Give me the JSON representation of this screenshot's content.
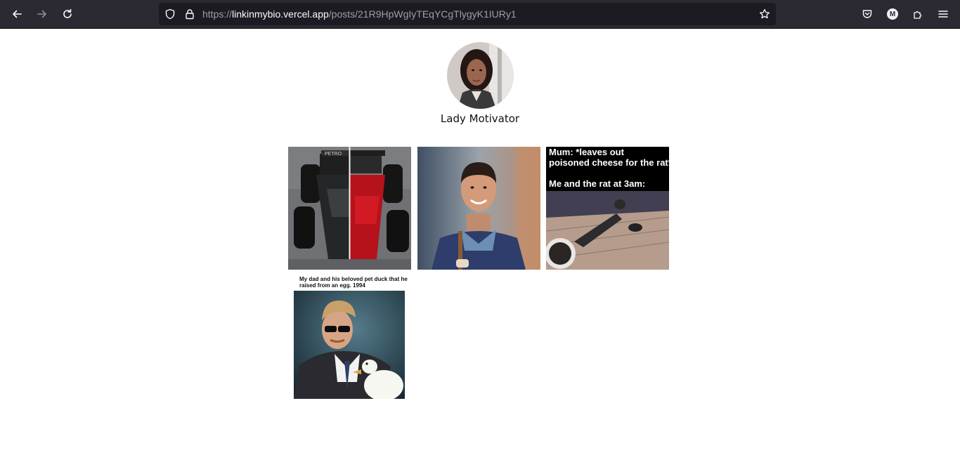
{
  "browser": {
    "url_prefix": "https://",
    "url_host": "linkinmybio.vercel.app",
    "url_path": "/posts/21R9HpWgIyTEqYCgTlygyK1IURy1",
    "account_initial": "M",
    "icons": [
      "back-arrow-icon",
      "forward-arrow-icon",
      "reload-icon",
      "shield-icon",
      "lock-icon",
      "star-icon",
      "pocket-icon",
      "account-icon",
      "extensions-icon",
      "menu-icon"
    ]
  },
  "profile": {
    "name": "Lady Motivator"
  },
  "posts": [
    {
      "name": "f1-cars"
    },
    {
      "name": "smiling-man"
    },
    {
      "name": "rat-meme",
      "line1": "Mum: *leaves out",
      "line2": "poisoned cheese for the rat*",
      "line3": "Me and the rat at 3am:"
    },
    {
      "name": "duck-photo",
      "caption1": "My dad and his beloved pet duck that he",
      "caption2": "raised from an egg. 1994"
    }
  ],
  "colors": {
    "toolbar_bg": "#2b2a33",
    "urlbar_bg": "#1c1b22",
    "page_bg": "#ffffff"
  }
}
